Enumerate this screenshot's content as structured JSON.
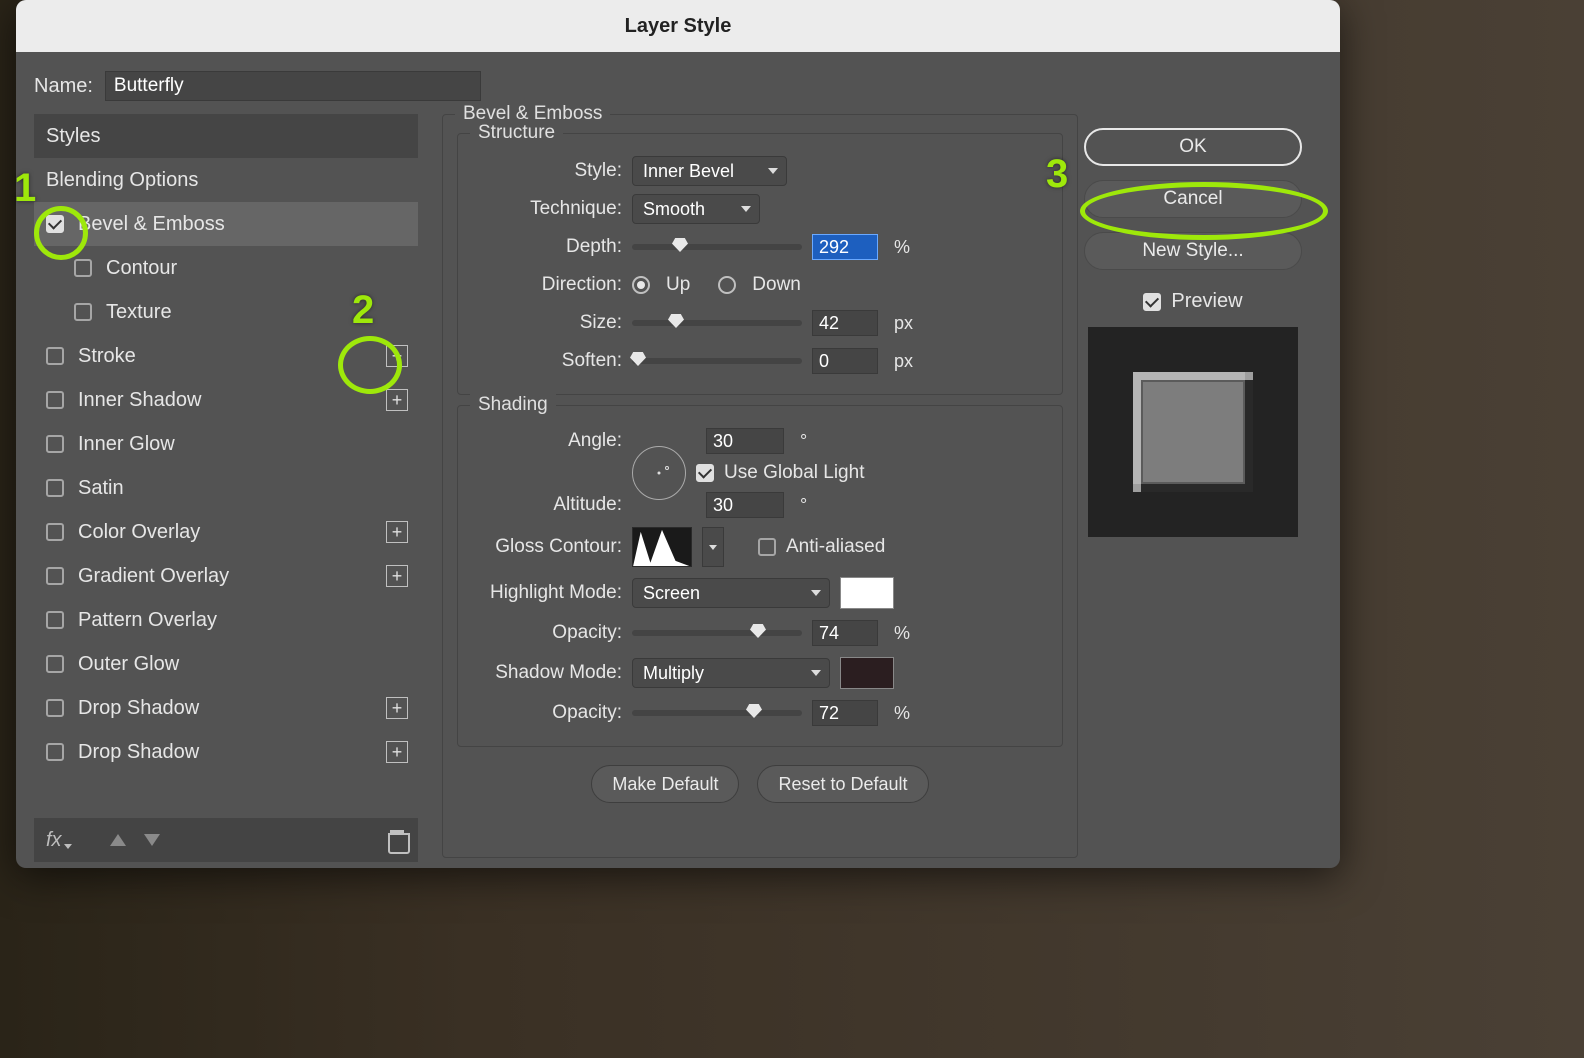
{
  "dialog": {
    "title": "Layer Style"
  },
  "name": {
    "label": "Name:",
    "value": "Butterfly"
  },
  "styles": {
    "header": "Styles",
    "blending": "Blending Options",
    "items": [
      {
        "label": "Bevel & Emboss",
        "checked": true,
        "selected": true,
        "plus": false,
        "indent": false
      },
      {
        "label": "Contour",
        "checked": false,
        "selected": false,
        "plus": false,
        "indent": true
      },
      {
        "label": "Texture",
        "checked": false,
        "selected": false,
        "plus": false,
        "indent": true
      },
      {
        "label": "Stroke",
        "checked": false,
        "selected": false,
        "plus": true,
        "indent": false
      },
      {
        "label": "Inner Shadow",
        "checked": false,
        "selected": false,
        "plus": true,
        "indent": false
      },
      {
        "label": "Inner Glow",
        "checked": false,
        "selected": false,
        "plus": false,
        "indent": false
      },
      {
        "label": "Satin",
        "checked": false,
        "selected": false,
        "plus": false,
        "indent": false
      },
      {
        "label": "Color Overlay",
        "checked": false,
        "selected": false,
        "plus": true,
        "indent": false
      },
      {
        "label": "Gradient Overlay",
        "checked": false,
        "selected": false,
        "plus": true,
        "indent": false
      },
      {
        "label": "Pattern Overlay",
        "checked": false,
        "selected": false,
        "plus": false,
        "indent": false
      },
      {
        "label": "Outer Glow",
        "checked": false,
        "selected": false,
        "plus": false,
        "indent": false
      },
      {
        "label": "Drop Shadow",
        "checked": false,
        "selected": false,
        "plus": true,
        "indent": false
      },
      {
        "label": "Drop Shadow",
        "checked": false,
        "selected": false,
        "plus": true,
        "indent": false
      }
    ],
    "footer_fx": "fx"
  },
  "bevel": {
    "panel_title": "Bevel & Emboss",
    "structure_title": "Structure",
    "style_label": "Style:",
    "style_value": "Inner Bevel",
    "technique_label": "Technique:",
    "technique_value": "Smooth",
    "depth_label": "Depth:",
    "depth_value": "292",
    "depth_unit": "%",
    "direction_label": "Direction:",
    "up": "Up",
    "down": "Down",
    "size_label": "Size:",
    "size_value": "42",
    "size_unit": "px",
    "soften_label": "Soften:",
    "soften_value": "0",
    "soften_unit": "px",
    "shading_title": "Shading",
    "angle_label": "Angle:",
    "angle_value": "30",
    "angle_unit": "°",
    "global_light": "Use Global Light",
    "altitude_label": "Altitude:",
    "altitude_value": "30",
    "altitude_unit": "°",
    "gloss_label": "Gloss Contour:",
    "antialiased": "Anti-aliased",
    "highlight_label": "Highlight Mode:",
    "highlight_value": "Screen",
    "highlight_op_label": "Opacity:",
    "highlight_op_value": "74",
    "highlight_op_unit": "%",
    "shadow_label": "Shadow Mode:",
    "shadow_value": "Multiply",
    "shadow_op_label": "Opacity:",
    "shadow_op_value": "72",
    "shadow_op_unit": "%",
    "make_default": "Make Default",
    "reset_default": "Reset to Default"
  },
  "right": {
    "ok": "OK",
    "cancel": "Cancel",
    "new_style": "New Style...",
    "preview": "Preview"
  },
  "annot": {
    "n1": "1",
    "n2": "2",
    "n3": "3"
  }
}
